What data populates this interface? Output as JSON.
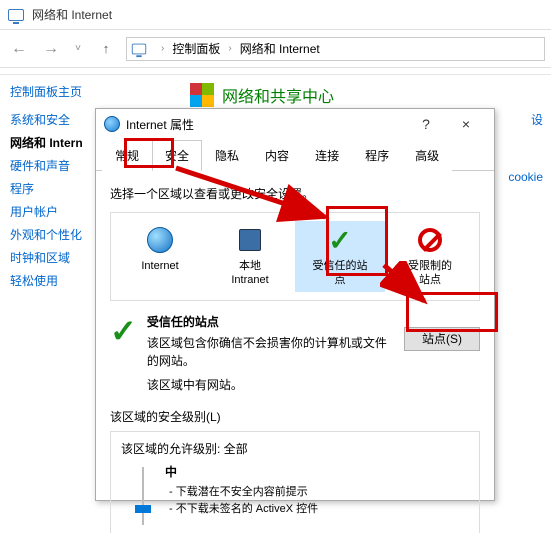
{
  "explorer": {
    "title": "网络和 Internet",
    "breadcrumb": {
      "control_panel": "控制面板",
      "net": "网络和 Internet"
    },
    "sidebar_title": "控制面板主页",
    "sidebar_items": [
      "系统和安全",
      "网络和 Intern",
      "硬件和声音",
      "程序",
      "用户帐户",
      "外观和个性化",
      "时钟和区域",
      "轻松使用"
    ],
    "heading": "网络和共享中心",
    "right_links": [
      "设",
      "cookie"
    ]
  },
  "dialog": {
    "title": "Internet 属性",
    "help": "?",
    "close": "×",
    "tabs": [
      "常规",
      "安全",
      "隐私",
      "内容",
      "连接",
      "程序",
      "高级"
    ],
    "active_tab_index": 1,
    "prompt": "选择一个区域以查看或更改安全设置。",
    "zones": [
      {
        "label": "Internet"
      },
      {
        "label": "本地\nIntranet"
      },
      {
        "label": "受信任的站\n点"
      },
      {
        "label": "受限制的\n站点"
      }
    ],
    "selected_zone_index": 2,
    "zone_title": "受信任的站点",
    "zone_desc1": "该区域包含你确信不会损害你的计算机或文件的网站。",
    "zone_desc2": "该区域中有网站。",
    "sites_button": "站点(S)",
    "sec_level_label": "该区域的安全级别(L)",
    "allow_levels": "该区域的允许级别: 全部",
    "slider_value": "中",
    "bullets": [
      "- 下载潜在不安全内容前提示",
      "- 不下载未签名的 ActiveX 控件"
    ]
  }
}
